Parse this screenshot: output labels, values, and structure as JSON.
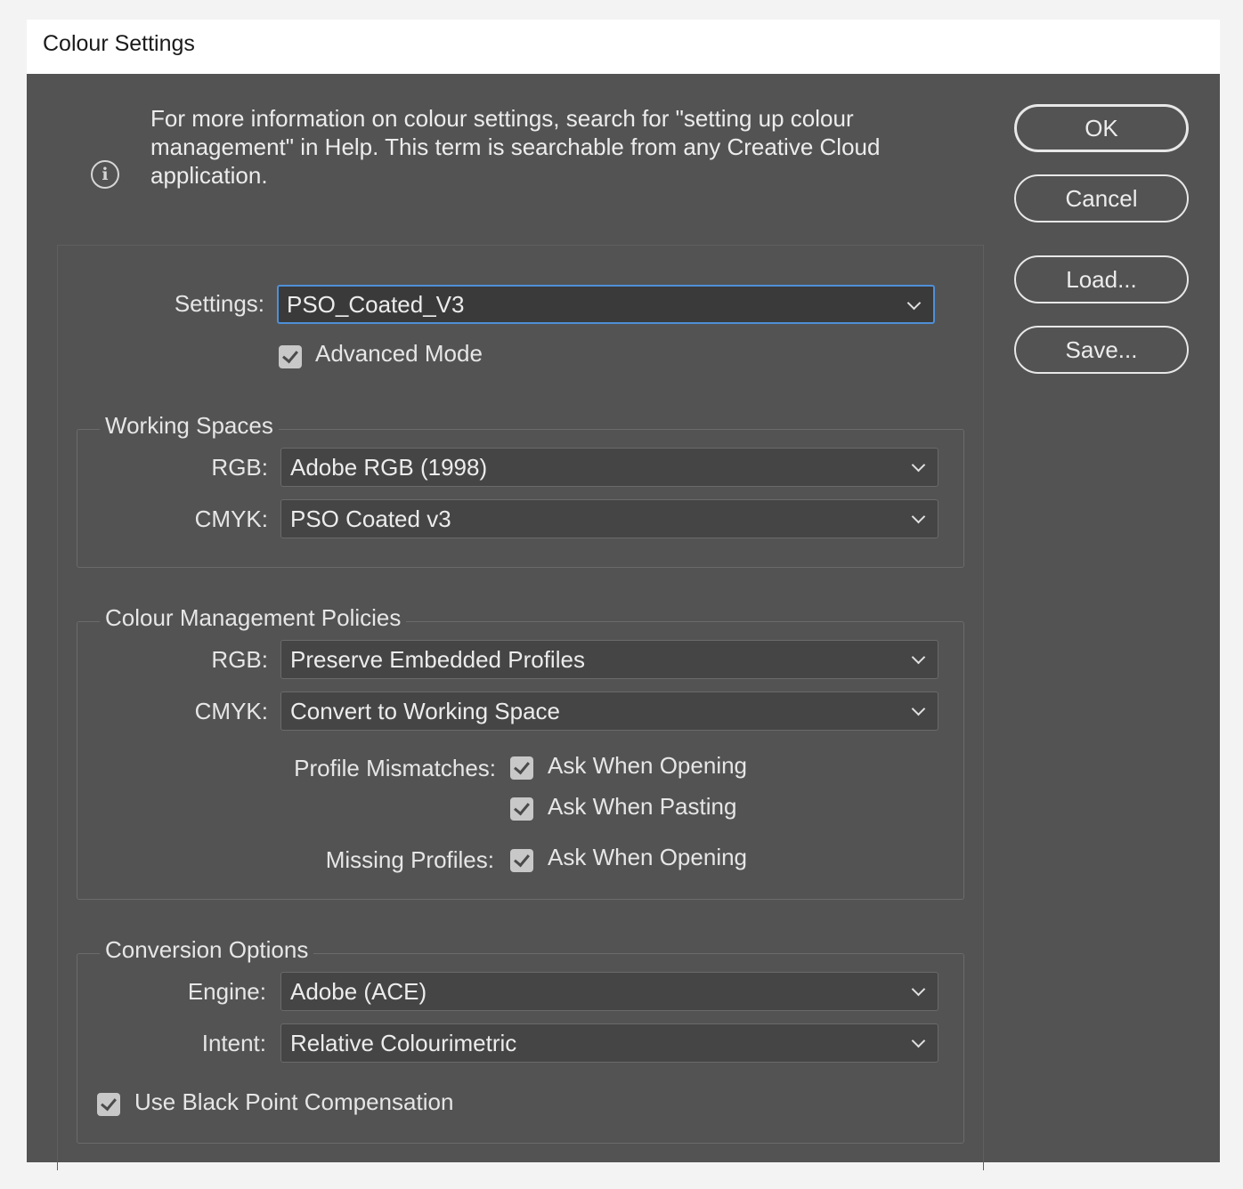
{
  "window": {
    "title": "Colour Settings"
  },
  "info": {
    "icon": "info-icon",
    "text": "For more information on colour settings, search for \"setting up colour management\" in Help. This term is searchable from any Creative Cloud application."
  },
  "buttons": {
    "ok": "OK",
    "cancel": "Cancel",
    "load": "Load...",
    "save": "Save..."
  },
  "settings": {
    "label": "Settings:",
    "value": "PSO_Coated_V3",
    "advanced_mode": {
      "label": "Advanced Mode",
      "checked": true
    }
  },
  "working_spaces": {
    "title": "Working Spaces",
    "rgb": {
      "label": "RGB:",
      "value": "Adobe RGB (1998)"
    },
    "cmyk": {
      "label": "CMYK:",
      "value": "PSO Coated v3"
    }
  },
  "policies": {
    "title": "Colour Management Policies",
    "rgb": {
      "label": "RGB:",
      "value": "Preserve Embedded Profiles"
    },
    "cmyk": {
      "label": "CMYK:",
      "value": "Convert to Working Space"
    },
    "profile_mismatches": {
      "label": "Profile Mismatches:",
      "ask_opening": {
        "label": "Ask When Opening",
        "checked": true
      },
      "ask_pasting": {
        "label": "Ask When Pasting",
        "checked": true
      }
    },
    "missing_profiles": {
      "label": "Missing Profiles:",
      "ask_opening": {
        "label": "Ask When Opening",
        "checked": true
      }
    }
  },
  "conversion": {
    "title": "Conversion Options",
    "engine": {
      "label": "Engine:",
      "value": "Adobe (ACE)"
    },
    "intent": {
      "label": "Intent:",
      "value": "Relative Colourimetric"
    },
    "black_point": {
      "label": "Use Black Point Compensation",
      "checked": true
    }
  },
  "colors": {
    "dialog_bg": "#535353",
    "titlebar_bg": "#ffffff",
    "focus_accent": "#4f8fd8"
  }
}
